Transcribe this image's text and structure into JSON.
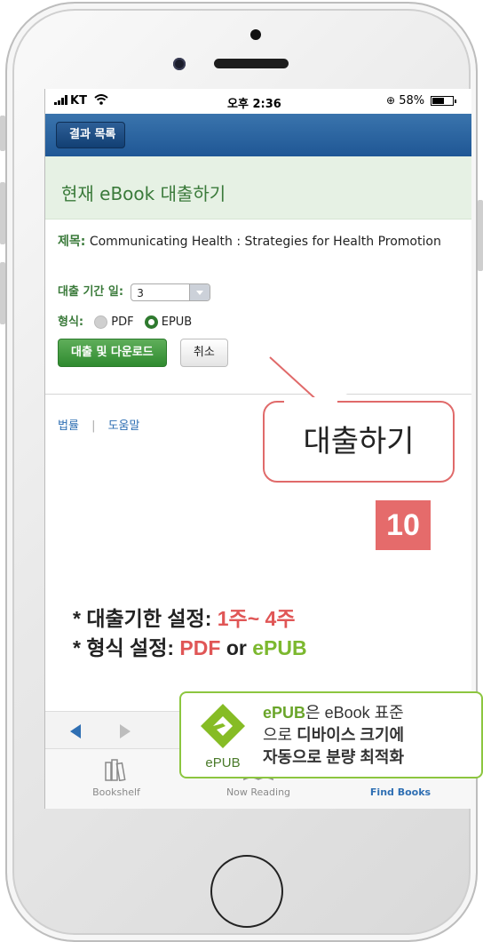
{
  "status_bar": {
    "carrier": "KT",
    "time": "오후 2:36",
    "battery": "58%",
    "battery_level": 0.58
  },
  "nav": {
    "back_label": "결과 목록"
  },
  "header": {
    "title": "현재 eBook 대출하기"
  },
  "form": {
    "title_label": "제목:",
    "title_value": "Communicating Health : Strategies for Health Promotion",
    "period_label": "대출 기간 일:",
    "period_value": "3",
    "format_label": "형식:",
    "format_options": [
      {
        "label": "PDF",
        "selected": false
      },
      {
        "label": "EPUB",
        "selected": true
      }
    ],
    "checkout_button": "대출 및 다운로드",
    "cancel_button": "취소"
  },
  "footer_links": {
    "legal": "법률",
    "separator": "|",
    "help": "도움말"
  },
  "tabs": [
    {
      "label": "Bookshelf",
      "icon": "bookshelf-icon",
      "active": false
    },
    {
      "label": "Now Reading",
      "icon": "open-book-icon",
      "active": false
    },
    {
      "label": "Find Books",
      "icon": "download-icon",
      "active": true
    }
  ],
  "callout": {
    "text": "대출하기",
    "step_number": "10"
  },
  "notes": {
    "line1_prefix": "* 대출기한 설정:",
    "line1_value": "1주~ 4주",
    "line2_prefix": "* 형식 설정:",
    "line2_pdf": "PDF",
    "line2_or": "or",
    "line2_epub": "ePUB"
  },
  "epub_info": {
    "logo_text": "ePUB",
    "line1_bold": "ePUB",
    "line1_rest": "은 eBook 표준",
    "line2_plain": "으로",
    "line2_bold": "디바이스 크기에",
    "line3": "자동으로 분량 최적화"
  },
  "colors": {
    "nav_blue": "#1f5795",
    "accent_green": "#2f8a2f",
    "callout_red": "#e06a6a",
    "epub_green": "#8cc63f",
    "link_blue": "#2f6fb3"
  }
}
